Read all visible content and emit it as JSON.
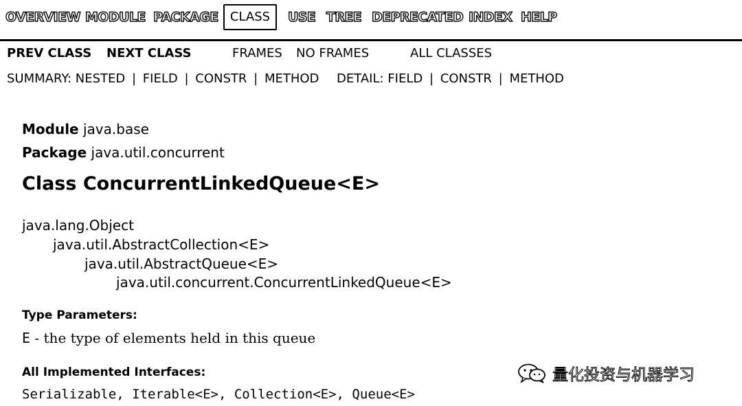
{
  "topnav": {
    "items": [
      "OVERVIEW",
      "MODULE",
      "PACKAGE",
      "CLASS",
      "USE",
      "TREE",
      "DEPRECATED",
      "INDEX",
      "HELP"
    ],
    "active": "CLASS"
  },
  "subnav": {
    "prev_class": "PREV CLASS",
    "next_class": "NEXT CLASS",
    "frames": "FRAMES",
    "no_frames": "NO FRAMES",
    "all_classes": "ALL CLASSES"
  },
  "summary": {
    "label": "SUMMARY:",
    "items": [
      "NESTED",
      "FIELD",
      "CONSTR",
      "METHOD"
    ],
    "separator": "|"
  },
  "detail": {
    "label": "DETAIL:",
    "items": [
      "FIELD",
      "CONSTR",
      "METHOD"
    ],
    "separator": "|"
  },
  "header": {
    "module_label": "Module",
    "module_value": "java.base",
    "package_label": "Package",
    "package_value": "java.util.concurrent",
    "class_title": "Class ConcurrentLinkedQueue<E>"
  },
  "hierarchy": [
    "java.lang.Object",
    "java.util.AbstractCollection<E>",
    "java.util.AbstractQueue<E>",
    "java.util.concurrent.ConcurrentLinkedQueue<E>"
  ],
  "type_parameters": {
    "label": "Type Parameters:",
    "param": "E",
    "description": " - the type of elements held in this queue"
  },
  "interfaces": {
    "label": "All Implemented Interfaces:",
    "value": "Serializable, Iterable<E>, Collection<E>, Queue<E>"
  },
  "watermark": {
    "text": "量化投资与机器学习",
    "icon": "wechat-icon"
  }
}
